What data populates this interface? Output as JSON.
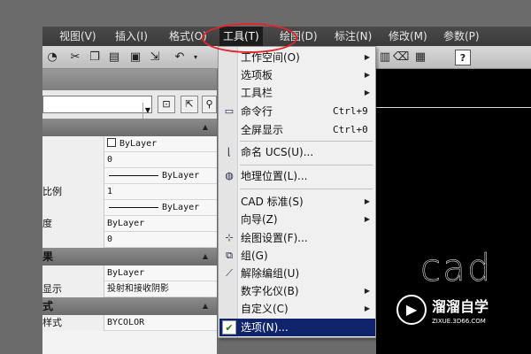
{
  "menubar": {
    "items": [
      "视图(V)",
      "插入(I)",
      "格式(O)",
      "工具(T)",
      "绘图(D)",
      "标注(N)",
      "修改(M)",
      "参数(P)"
    ],
    "active_index": 3
  },
  "toolbar": {
    "icons": [
      "palette-icon",
      "cut-icon",
      "copy-icon",
      "paste-icon",
      "match-properties-icon",
      "block-editor-icon",
      "undo-icon",
      "redo-icon",
      "help-icon"
    ],
    "help_glyph": "?"
  },
  "properties": {
    "groups": [
      "",
      "果",
      "式"
    ],
    "rows": [
      {
        "name": "",
        "value": "ByLayer",
        "has_check": true
      },
      {
        "name": "",
        "value": "0"
      },
      {
        "name": "",
        "value": "ByLayer",
        "has_line": true
      },
      {
        "name": "比例",
        "value": "1"
      },
      {
        "name": "",
        "value": "ByLayer",
        "has_line": true
      },
      {
        "name": "度",
        "value": "ByLayer"
      },
      {
        "name": "",
        "value": "0"
      },
      {
        "name": "",
        "value": "ByLayer"
      },
      {
        "name": "显示",
        "value": "投射和接收阴影"
      },
      {
        "name": "样式",
        "value": "BYCOLOR"
      }
    ]
  },
  "tools_menu": {
    "items": [
      {
        "label": "工作空间(O)",
        "submenu": true
      },
      {
        "label": "选项板",
        "submenu": true
      },
      {
        "label": "工具栏",
        "submenu": true
      },
      {
        "label": "命令行",
        "shortcut": "Ctrl+9",
        "icon": "command-line-icon"
      },
      {
        "label": "全屏显示",
        "shortcut": "Ctrl+0"
      },
      {
        "label": "命名 UCS(U)...",
        "icon": "ucs-icon"
      },
      {
        "label": "地理位置(L)...",
        "icon": "globe-icon"
      },
      {
        "label": "CAD 标准(S)",
        "submenu": true
      },
      {
        "label": "向导(Z)",
        "submenu": true
      },
      {
        "label": "绘图设置(F)...",
        "icon": "drafting-settings-icon"
      },
      {
        "label": "组(G)",
        "icon": "group-icon"
      },
      {
        "label": "解除编组(U)",
        "icon": "ungroup-icon"
      },
      {
        "label": "数字化仪(B)",
        "submenu": true
      },
      {
        "label": "自定义(C)",
        "submenu": true
      },
      {
        "label": "选项(N)...",
        "icon": "checkmark-icon",
        "selected": true
      }
    ]
  },
  "canvas": {
    "text": "cad"
  },
  "watermark": {
    "name": "溜溜自学",
    "url": "ZIXUE.3D66.COM"
  },
  "colors": {
    "menu_highlight": "#10246b",
    "annotation": "#e0262b",
    "canvas": "#000000"
  }
}
